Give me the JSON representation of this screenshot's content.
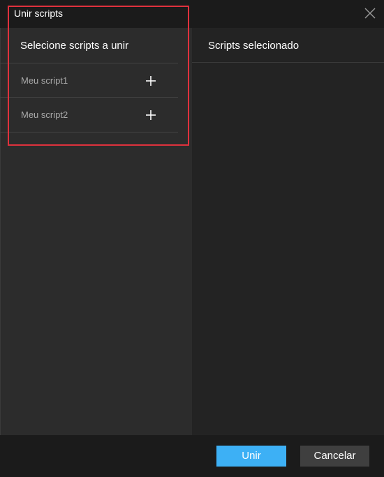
{
  "dialog": {
    "title": "Unir scripts"
  },
  "left_pane": {
    "heading": "Selecione scripts a unir",
    "scripts": [
      {
        "label": "Meu script1",
        "action_icon": "plus-icon"
      },
      {
        "label": "Meu script2",
        "action_icon": "plus-icon"
      }
    ]
  },
  "right_pane": {
    "heading": "Scripts selecionado"
  },
  "footer": {
    "confirm_label": "Unir",
    "cancel_label": "Cancelar"
  },
  "colors": {
    "accent": "#3db0f5",
    "highlight": "#e0313d",
    "background": "#1b1b1b",
    "left_pane": "#2c2c2c",
    "right_pane": "#232323"
  },
  "icons": {
    "close": "close-icon",
    "add": "plus-icon"
  }
}
